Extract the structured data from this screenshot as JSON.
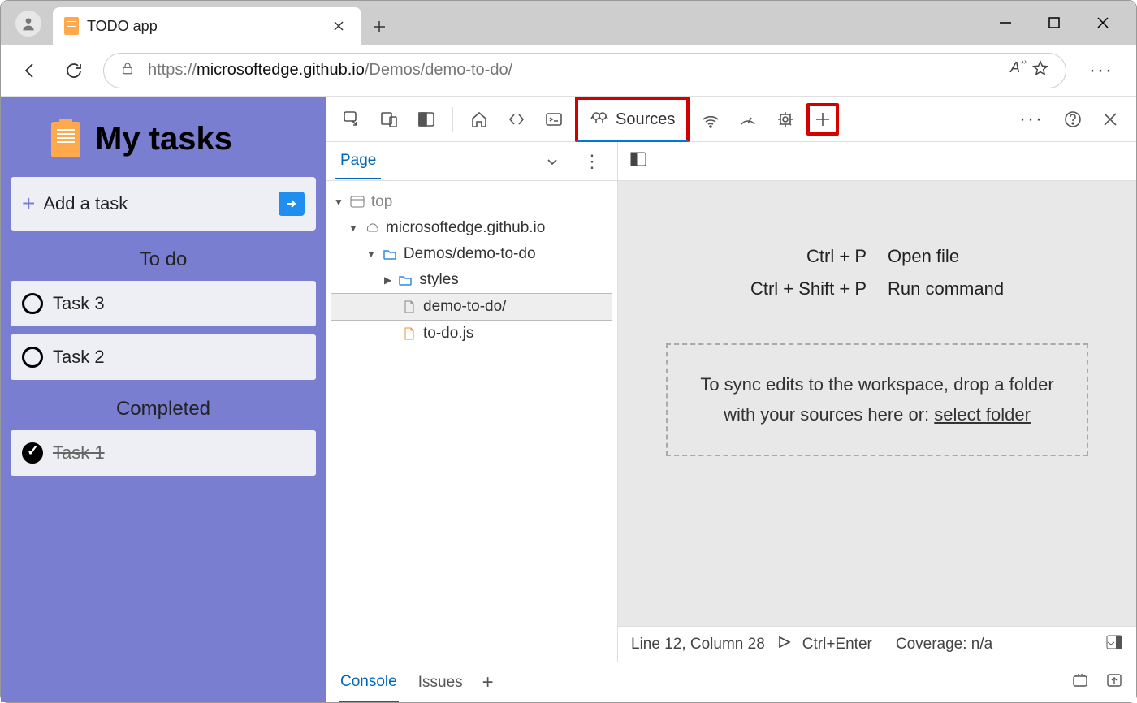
{
  "window": {
    "tab_title": "TODO app",
    "url_scheme": "https://",
    "url_host": "microsoftedge.github.io",
    "url_path": "/Demos/demo-to-do/"
  },
  "app": {
    "title": "My tasks",
    "add_placeholder": "Add a task",
    "sections": {
      "todo": "To do",
      "completed": "Completed"
    },
    "tasks_todo": [
      {
        "label": "Task 3"
      },
      {
        "label": "Task 2"
      }
    ],
    "tasks_done": [
      {
        "label": "Task 1"
      }
    ]
  },
  "devtools": {
    "active_tool": "Sources",
    "nav_tab": "Page",
    "tree": {
      "top": "top",
      "origin": "microsoftedge.github.io",
      "folder": "Demos/demo-to-do",
      "styles": "styles",
      "index": "demo-to-do/",
      "js": "to-do.js"
    },
    "shortcuts": [
      {
        "key": "Ctrl + P",
        "action": "Open file"
      },
      {
        "key": "Ctrl + Shift + P",
        "action": "Run command"
      }
    ],
    "dropzone_line1": "To sync edits to the workspace, drop a folder",
    "dropzone_line2a": "with your sources here or: ",
    "dropzone_link": "select folder",
    "status": {
      "pos": "Line 12, Column 28",
      "run_hint": "Ctrl+Enter",
      "coverage": "Coverage: n/a"
    },
    "drawer": {
      "console": "Console",
      "issues": "Issues"
    }
  }
}
